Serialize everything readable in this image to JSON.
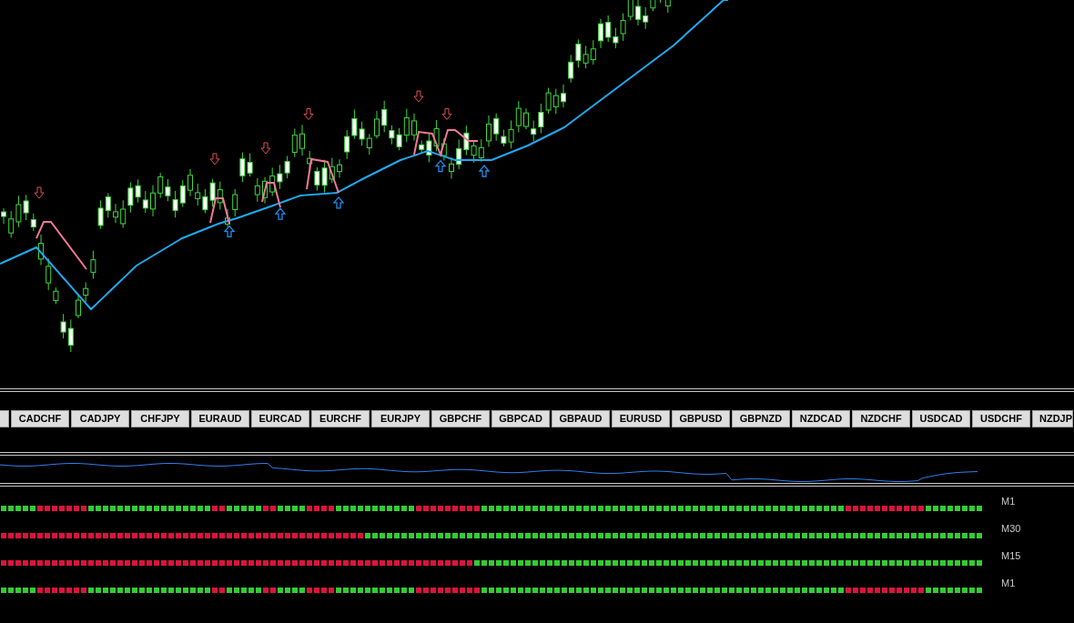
{
  "pair_buttons": [
    {
      "label": "CADCHF"
    },
    {
      "label": "CADJPY"
    },
    {
      "label": "CHFJPY"
    },
    {
      "label": "EURAUD"
    },
    {
      "label": "EURCAD"
    },
    {
      "label": "EURCHF"
    },
    {
      "label": "EURJPY"
    },
    {
      "label": "GBPCHF"
    },
    {
      "label": "GBPCAD"
    },
    {
      "label": "GBPAUD"
    },
    {
      "label": "EURUSD"
    },
    {
      "label": "GBPUSD"
    },
    {
      "label": "GBPNZD"
    },
    {
      "label": "NZDCAD"
    },
    {
      "label": "NZDCHF"
    },
    {
      "label": "USDCAD"
    },
    {
      "label": "USDCHF"
    },
    {
      "label": "NZDJP"
    }
  ],
  "signal_rows": [
    {
      "label": "M1",
      "cells": [
        {
          "color": "#33cc33"
        },
        {
          "color": "#33cc33"
        },
        {
          "color": "#33cc33"
        },
        {
          "color": "#33cc33"
        },
        {
          "color": "#33cc33"
        },
        {
          "color": "#dc143c"
        },
        {
          "color": "#dc143c"
        },
        {
          "color": "#dc143c"
        },
        {
          "color": "#dc143c"
        },
        {
          "color": "#dc143c"
        },
        {
          "color": "#dc143c"
        },
        {
          "color": "#dc143c"
        },
        {
          "color": "#33cc33"
        },
        {
          "color": "#33cc33"
        },
        {
          "color": "#33cc33"
        },
        {
          "color": "#33cc33"
        },
        {
          "color": "#33cc33"
        },
        {
          "color": "#33cc33"
        },
        {
          "color": "#33cc33"
        },
        {
          "color": "#33cc33"
        },
        {
          "color": "#33cc33"
        },
        {
          "color": "#33cc33"
        },
        {
          "color": "#33cc33"
        },
        {
          "color": "#33cc33"
        },
        {
          "color": "#33cc33"
        },
        {
          "color": "#33cc33"
        },
        {
          "color": "#33cc33"
        },
        {
          "color": "#33cc33"
        },
        {
          "color": "#33cc33"
        },
        {
          "color": "#dc143c"
        },
        {
          "color": "#dc143c"
        },
        {
          "color": "#33cc33"
        },
        {
          "color": "#33cc33"
        },
        {
          "color": "#33cc33"
        },
        {
          "color": "#33cc33"
        },
        {
          "color": "#33cc33"
        },
        {
          "color": "#dc143c"
        },
        {
          "color": "#dc143c"
        },
        {
          "color": "#33cc33"
        },
        {
          "color": "#33cc33"
        },
        {
          "color": "#33cc33"
        },
        {
          "color": "#33cc33"
        },
        {
          "color": "#dc143c"
        },
        {
          "color": "#dc143c"
        },
        {
          "color": "#dc143c"
        },
        {
          "color": "#dc143c"
        },
        {
          "color": "#33cc33"
        },
        {
          "color": "#33cc33"
        },
        {
          "color": "#33cc33"
        },
        {
          "color": "#33cc33"
        },
        {
          "color": "#33cc33"
        },
        {
          "color": "#33cc33"
        },
        {
          "color": "#33cc33"
        },
        {
          "color": "#33cc33"
        },
        {
          "color": "#33cc33"
        },
        {
          "color": "#33cc33"
        },
        {
          "color": "#33cc33"
        },
        {
          "color": "#dc143c"
        },
        {
          "color": "#dc143c"
        },
        {
          "color": "#dc143c"
        },
        {
          "color": "#dc143c"
        },
        {
          "color": "#dc143c"
        },
        {
          "color": "#dc143c"
        },
        {
          "color": "#dc143c"
        },
        {
          "color": "#dc143c"
        },
        {
          "color": "#dc143c"
        },
        {
          "color": "#33cc33"
        },
        {
          "color": "#33cc33"
        },
        {
          "color": "#33cc33"
        },
        {
          "color": "#33cc33"
        },
        {
          "color": "#33cc33"
        },
        {
          "color": "#33cc33"
        },
        {
          "color": "#33cc33"
        },
        {
          "color": "#33cc33"
        },
        {
          "color": "#33cc33"
        },
        {
          "color": "#33cc33"
        },
        {
          "color": "#33cc33"
        },
        {
          "color": "#33cc33"
        },
        {
          "color": "#33cc33"
        },
        {
          "color": "#33cc33"
        },
        {
          "color": "#33cc33"
        },
        {
          "color": "#33cc33"
        },
        {
          "color": "#33cc33"
        },
        {
          "color": "#33cc33"
        },
        {
          "color": "#33cc33"
        },
        {
          "color": "#33cc33"
        },
        {
          "color": "#33cc33"
        },
        {
          "color": "#33cc33"
        },
        {
          "color": "#33cc33"
        },
        {
          "color": "#33cc33"
        },
        {
          "color": "#33cc33"
        },
        {
          "color": "#33cc33"
        },
        {
          "color": "#33cc33"
        },
        {
          "color": "#33cc33"
        },
        {
          "color": "#33cc33"
        },
        {
          "color": "#33cc33"
        },
        {
          "color": "#33cc33"
        },
        {
          "color": "#33cc33"
        },
        {
          "color": "#33cc33"
        },
        {
          "color": "#33cc33"
        },
        {
          "color": "#33cc33"
        },
        {
          "color": "#33cc33"
        },
        {
          "color": "#33cc33"
        },
        {
          "color": "#33cc33"
        },
        {
          "color": "#33cc33"
        },
        {
          "color": "#33cc33"
        },
        {
          "color": "#33cc33"
        },
        {
          "color": "#33cc33"
        },
        {
          "color": "#33cc33"
        },
        {
          "color": "#33cc33"
        },
        {
          "color": "#33cc33"
        },
        {
          "color": "#33cc33"
        },
        {
          "color": "#33cc33"
        },
        {
          "color": "#33cc33"
        },
        {
          "color": "#33cc33"
        },
        {
          "color": "#33cc33"
        },
        {
          "color": "#dc143c"
        },
        {
          "color": "#dc143c"
        },
        {
          "color": "#dc143c"
        },
        {
          "color": "#dc143c"
        },
        {
          "color": "#dc143c"
        },
        {
          "color": "#dc143c"
        },
        {
          "color": "#dc143c"
        },
        {
          "color": "#dc143c"
        },
        {
          "color": "#dc143c"
        },
        {
          "color": "#dc143c"
        },
        {
          "color": "#dc143c"
        },
        {
          "color": "#33cc33"
        },
        {
          "color": "#33cc33"
        },
        {
          "color": "#33cc33"
        },
        {
          "color": "#33cc33"
        },
        {
          "color": "#33cc33"
        },
        {
          "color": "#33cc33"
        },
        {
          "color": "#33cc33"
        },
        {
          "color": "#33cc33"
        }
      ]
    },
    {
      "label": "M30",
      "cells": [
        {
          "color": "#dc143c"
        },
        {
          "color": "#dc143c"
        },
        {
          "color": "#dc143c"
        },
        {
          "color": "#dc143c"
        },
        {
          "color": "#dc143c"
        },
        {
          "color": "#dc143c"
        },
        {
          "color": "#dc143c"
        },
        {
          "color": "#dc143c"
        },
        {
          "color": "#dc143c"
        },
        {
          "color": "#dc143c"
        },
        {
          "color": "#dc143c"
        },
        {
          "color": "#dc143c"
        },
        {
          "color": "#dc143c"
        },
        {
          "color": "#dc143c"
        },
        {
          "color": "#dc143c"
        },
        {
          "color": "#dc143c"
        },
        {
          "color": "#dc143c"
        },
        {
          "color": "#dc143c"
        },
        {
          "color": "#dc143c"
        },
        {
          "color": "#dc143c"
        },
        {
          "color": "#dc143c"
        },
        {
          "color": "#dc143c"
        },
        {
          "color": "#dc143c"
        },
        {
          "color": "#dc143c"
        },
        {
          "color": "#dc143c"
        },
        {
          "color": "#dc143c"
        },
        {
          "color": "#dc143c"
        },
        {
          "color": "#dc143c"
        },
        {
          "color": "#dc143c"
        },
        {
          "color": "#dc143c"
        },
        {
          "color": "#dc143c"
        },
        {
          "color": "#dc143c"
        },
        {
          "color": "#dc143c"
        },
        {
          "color": "#dc143c"
        },
        {
          "color": "#dc143c"
        },
        {
          "color": "#dc143c"
        },
        {
          "color": "#dc143c"
        },
        {
          "color": "#dc143c"
        },
        {
          "color": "#dc143c"
        },
        {
          "color": "#dc143c"
        },
        {
          "color": "#dc143c"
        },
        {
          "color": "#dc143c"
        },
        {
          "color": "#dc143c"
        },
        {
          "color": "#dc143c"
        },
        {
          "color": "#dc143c"
        },
        {
          "color": "#dc143c"
        },
        {
          "color": "#dc143c"
        },
        {
          "color": "#dc143c"
        },
        {
          "color": "#dc143c"
        },
        {
          "color": "#dc143c"
        },
        {
          "color": "#33cc33"
        },
        {
          "color": "#33cc33"
        },
        {
          "color": "#33cc33"
        },
        {
          "color": "#33cc33"
        },
        {
          "color": "#33cc33"
        },
        {
          "color": "#33cc33"
        },
        {
          "color": "#33cc33"
        },
        {
          "color": "#33cc33"
        },
        {
          "color": "#33cc33"
        },
        {
          "color": "#33cc33"
        },
        {
          "color": "#33cc33"
        },
        {
          "color": "#33cc33"
        },
        {
          "color": "#33cc33"
        },
        {
          "color": "#33cc33"
        },
        {
          "color": "#33cc33"
        },
        {
          "color": "#33cc33"
        },
        {
          "color": "#33cc33"
        },
        {
          "color": "#33cc33"
        },
        {
          "color": "#33cc33"
        },
        {
          "color": "#33cc33"
        },
        {
          "color": "#33cc33"
        },
        {
          "color": "#33cc33"
        },
        {
          "color": "#33cc33"
        },
        {
          "color": "#33cc33"
        },
        {
          "color": "#33cc33"
        },
        {
          "color": "#33cc33"
        },
        {
          "color": "#33cc33"
        },
        {
          "color": "#33cc33"
        },
        {
          "color": "#33cc33"
        },
        {
          "color": "#33cc33"
        },
        {
          "color": "#33cc33"
        },
        {
          "color": "#33cc33"
        },
        {
          "color": "#33cc33"
        },
        {
          "color": "#33cc33"
        },
        {
          "color": "#33cc33"
        },
        {
          "color": "#33cc33"
        },
        {
          "color": "#33cc33"
        },
        {
          "color": "#33cc33"
        },
        {
          "color": "#33cc33"
        },
        {
          "color": "#33cc33"
        },
        {
          "color": "#33cc33"
        },
        {
          "color": "#33cc33"
        },
        {
          "color": "#33cc33"
        },
        {
          "color": "#33cc33"
        },
        {
          "color": "#33cc33"
        },
        {
          "color": "#33cc33"
        },
        {
          "color": "#33cc33"
        },
        {
          "color": "#33cc33"
        },
        {
          "color": "#33cc33"
        },
        {
          "color": "#33cc33"
        },
        {
          "color": "#33cc33"
        },
        {
          "color": "#33cc33"
        },
        {
          "color": "#33cc33"
        },
        {
          "color": "#33cc33"
        },
        {
          "color": "#33cc33"
        },
        {
          "color": "#33cc33"
        },
        {
          "color": "#33cc33"
        },
        {
          "color": "#33cc33"
        },
        {
          "color": "#33cc33"
        },
        {
          "color": "#33cc33"
        },
        {
          "color": "#33cc33"
        },
        {
          "color": "#33cc33"
        },
        {
          "color": "#33cc33"
        },
        {
          "color": "#33cc33"
        },
        {
          "color": "#33cc33"
        },
        {
          "color": "#33cc33"
        },
        {
          "color": "#33cc33"
        },
        {
          "color": "#33cc33"
        },
        {
          "color": "#33cc33"
        },
        {
          "color": "#33cc33"
        },
        {
          "color": "#33cc33"
        },
        {
          "color": "#33cc33"
        },
        {
          "color": "#33cc33"
        },
        {
          "color": "#33cc33"
        },
        {
          "color": "#33cc33"
        },
        {
          "color": "#33cc33"
        },
        {
          "color": "#33cc33"
        },
        {
          "color": "#33cc33"
        },
        {
          "color": "#33cc33"
        },
        {
          "color": "#33cc33"
        },
        {
          "color": "#33cc33"
        },
        {
          "color": "#33cc33"
        },
        {
          "color": "#33cc33"
        },
        {
          "color": "#33cc33"
        },
        {
          "color": "#33cc33"
        }
      ]
    },
    {
      "label": "M15",
      "cells": [
        {
          "color": "#dc143c"
        },
        {
          "color": "#dc143c"
        },
        {
          "color": "#dc143c"
        },
        {
          "color": "#dc143c"
        },
        {
          "color": "#dc143c"
        },
        {
          "color": "#dc143c"
        },
        {
          "color": "#dc143c"
        },
        {
          "color": "#dc143c"
        },
        {
          "color": "#dc143c"
        },
        {
          "color": "#dc143c"
        },
        {
          "color": "#dc143c"
        },
        {
          "color": "#dc143c"
        },
        {
          "color": "#dc143c"
        },
        {
          "color": "#dc143c"
        },
        {
          "color": "#dc143c"
        },
        {
          "color": "#dc143c"
        },
        {
          "color": "#dc143c"
        },
        {
          "color": "#dc143c"
        },
        {
          "color": "#dc143c"
        },
        {
          "color": "#dc143c"
        },
        {
          "color": "#dc143c"
        },
        {
          "color": "#dc143c"
        },
        {
          "color": "#dc143c"
        },
        {
          "color": "#dc143c"
        },
        {
          "color": "#dc143c"
        },
        {
          "color": "#dc143c"
        },
        {
          "color": "#dc143c"
        },
        {
          "color": "#dc143c"
        },
        {
          "color": "#dc143c"
        },
        {
          "color": "#dc143c"
        },
        {
          "color": "#dc143c"
        },
        {
          "color": "#dc143c"
        },
        {
          "color": "#dc143c"
        },
        {
          "color": "#dc143c"
        },
        {
          "color": "#dc143c"
        },
        {
          "color": "#dc143c"
        },
        {
          "color": "#dc143c"
        },
        {
          "color": "#dc143c"
        },
        {
          "color": "#dc143c"
        },
        {
          "color": "#dc143c"
        },
        {
          "color": "#dc143c"
        },
        {
          "color": "#dc143c"
        },
        {
          "color": "#dc143c"
        },
        {
          "color": "#dc143c"
        },
        {
          "color": "#dc143c"
        },
        {
          "color": "#dc143c"
        },
        {
          "color": "#dc143c"
        },
        {
          "color": "#dc143c"
        },
        {
          "color": "#dc143c"
        },
        {
          "color": "#dc143c"
        },
        {
          "color": "#dc143c"
        },
        {
          "color": "#dc143c"
        },
        {
          "color": "#dc143c"
        },
        {
          "color": "#dc143c"
        },
        {
          "color": "#dc143c"
        },
        {
          "color": "#dc143c"
        },
        {
          "color": "#dc143c"
        },
        {
          "color": "#dc143c"
        },
        {
          "color": "#dc143c"
        },
        {
          "color": "#dc143c"
        },
        {
          "color": "#dc143c"
        },
        {
          "color": "#dc143c"
        },
        {
          "color": "#dc143c"
        },
        {
          "color": "#dc143c"
        },
        {
          "color": "#dc143c"
        },
        {
          "color": "#33cc33"
        },
        {
          "color": "#33cc33"
        },
        {
          "color": "#33cc33"
        },
        {
          "color": "#33cc33"
        },
        {
          "color": "#33cc33"
        },
        {
          "color": "#33cc33"
        },
        {
          "color": "#33cc33"
        },
        {
          "color": "#33cc33"
        },
        {
          "color": "#33cc33"
        },
        {
          "color": "#33cc33"
        },
        {
          "color": "#33cc33"
        },
        {
          "color": "#33cc33"
        },
        {
          "color": "#33cc33"
        },
        {
          "color": "#33cc33"
        },
        {
          "color": "#33cc33"
        },
        {
          "color": "#33cc33"
        },
        {
          "color": "#33cc33"
        },
        {
          "color": "#33cc33"
        },
        {
          "color": "#33cc33"
        },
        {
          "color": "#33cc33"
        },
        {
          "color": "#33cc33"
        },
        {
          "color": "#33cc33"
        },
        {
          "color": "#33cc33"
        },
        {
          "color": "#33cc33"
        },
        {
          "color": "#33cc33"
        },
        {
          "color": "#33cc33"
        },
        {
          "color": "#33cc33"
        },
        {
          "color": "#33cc33"
        },
        {
          "color": "#33cc33"
        },
        {
          "color": "#33cc33"
        },
        {
          "color": "#33cc33"
        },
        {
          "color": "#33cc33"
        },
        {
          "color": "#33cc33"
        },
        {
          "color": "#33cc33"
        },
        {
          "color": "#33cc33"
        },
        {
          "color": "#33cc33"
        },
        {
          "color": "#33cc33"
        },
        {
          "color": "#33cc33"
        },
        {
          "color": "#33cc33"
        },
        {
          "color": "#33cc33"
        },
        {
          "color": "#33cc33"
        },
        {
          "color": "#33cc33"
        },
        {
          "color": "#33cc33"
        },
        {
          "color": "#33cc33"
        },
        {
          "color": "#33cc33"
        },
        {
          "color": "#33cc33"
        },
        {
          "color": "#33cc33"
        },
        {
          "color": "#33cc33"
        },
        {
          "color": "#33cc33"
        },
        {
          "color": "#33cc33"
        },
        {
          "color": "#33cc33"
        },
        {
          "color": "#33cc33"
        },
        {
          "color": "#33cc33"
        },
        {
          "color": "#33cc33"
        },
        {
          "color": "#33cc33"
        },
        {
          "color": "#33cc33"
        },
        {
          "color": "#33cc33"
        },
        {
          "color": "#33cc33"
        },
        {
          "color": "#33cc33"
        },
        {
          "color": "#33cc33"
        },
        {
          "color": "#33cc33"
        },
        {
          "color": "#33cc33"
        },
        {
          "color": "#33cc33"
        },
        {
          "color": "#33cc33"
        },
        {
          "color": "#33cc33"
        },
        {
          "color": "#33cc33"
        },
        {
          "color": "#33cc33"
        },
        {
          "color": "#33cc33"
        },
        {
          "color": "#33cc33"
        },
        {
          "color": "#33cc33"
        }
      ]
    },
    {
      "label": "M1",
      "cells": [
        {
          "color": "#33cc33"
        },
        {
          "color": "#33cc33"
        },
        {
          "color": "#33cc33"
        },
        {
          "color": "#33cc33"
        },
        {
          "color": "#33cc33"
        },
        {
          "color": "#dc143c"
        },
        {
          "color": "#dc143c"
        },
        {
          "color": "#dc143c"
        },
        {
          "color": "#dc143c"
        },
        {
          "color": "#dc143c"
        },
        {
          "color": "#dc143c"
        },
        {
          "color": "#dc143c"
        },
        {
          "color": "#33cc33"
        },
        {
          "color": "#33cc33"
        },
        {
          "color": "#33cc33"
        },
        {
          "color": "#33cc33"
        },
        {
          "color": "#33cc33"
        },
        {
          "color": "#33cc33"
        },
        {
          "color": "#33cc33"
        },
        {
          "color": "#33cc33"
        },
        {
          "color": "#33cc33"
        },
        {
          "color": "#33cc33"
        },
        {
          "color": "#33cc33"
        },
        {
          "color": "#33cc33"
        },
        {
          "color": "#33cc33"
        },
        {
          "color": "#33cc33"
        },
        {
          "color": "#33cc33"
        },
        {
          "color": "#33cc33"
        },
        {
          "color": "#33cc33"
        },
        {
          "color": "#dc143c"
        },
        {
          "color": "#dc143c"
        },
        {
          "color": "#33cc33"
        },
        {
          "color": "#33cc33"
        },
        {
          "color": "#33cc33"
        },
        {
          "color": "#33cc33"
        },
        {
          "color": "#33cc33"
        },
        {
          "color": "#dc143c"
        },
        {
          "color": "#dc143c"
        },
        {
          "color": "#33cc33"
        },
        {
          "color": "#33cc33"
        },
        {
          "color": "#33cc33"
        },
        {
          "color": "#33cc33"
        },
        {
          "color": "#dc143c"
        },
        {
          "color": "#dc143c"
        },
        {
          "color": "#dc143c"
        },
        {
          "color": "#dc143c"
        },
        {
          "color": "#33cc33"
        },
        {
          "color": "#33cc33"
        },
        {
          "color": "#33cc33"
        },
        {
          "color": "#33cc33"
        },
        {
          "color": "#33cc33"
        },
        {
          "color": "#33cc33"
        },
        {
          "color": "#33cc33"
        },
        {
          "color": "#33cc33"
        },
        {
          "color": "#33cc33"
        },
        {
          "color": "#33cc33"
        },
        {
          "color": "#33cc33"
        },
        {
          "color": "#dc143c"
        },
        {
          "color": "#dc143c"
        },
        {
          "color": "#dc143c"
        },
        {
          "color": "#dc143c"
        },
        {
          "color": "#dc143c"
        },
        {
          "color": "#dc143c"
        },
        {
          "color": "#dc143c"
        },
        {
          "color": "#dc143c"
        },
        {
          "color": "#dc143c"
        },
        {
          "color": "#33cc33"
        },
        {
          "color": "#33cc33"
        },
        {
          "color": "#33cc33"
        },
        {
          "color": "#33cc33"
        },
        {
          "color": "#33cc33"
        },
        {
          "color": "#33cc33"
        },
        {
          "color": "#33cc33"
        },
        {
          "color": "#33cc33"
        },
        {
          "color": "#33cc33"
        },
        {
          "color": "#33cc33"
        },
        {
          "color": "#33cc33"
        },
        {
          "color": "#33cc33"
        },
        {
          "color": "#33cc33"
        },
        {
          "color": "#33cc33"
        },
        {
          "color": "#33cc33"
        },
        {
          "color": "#33cc33"
        },
        {
          "color": "#33cc33"
        },
        {
          "color": "#33cc33"
        },
        {
          "color": "#33cc33"
        },
        {
          "color": "#33cc33"
        },
        {
          "color": "#33cc33"
        },
        {
          "color": "#33cc33"
        },
        {
          "color": "#33cc33"
        },
        {
          "color": "#33cc33"
        },
        {
          "color": "#33cc33"
        },
        {
          "color": "#33cc33"
        },
        {
          "color": "#33cc33"
        },
        {
          "color": "#33cc33"
        },
        {
          "color": "#33cc33"
        },
        {
          "color": "#33cc33"
        },
        {
          "color": "#33cc33"
        },
        {
          "color": "#33cc33"
        },
        {
          "color": "#33cc33"
        },
        {
          "color": "#33cc33"
        },
        {
          "color": "#33cc33"
        },
        {
          "color": "#33cc33"
        },
        {
          "color": "#33cc33"
        },
        {
          "color": "#33cc33"
        },
        {
          "color": "#33cc33"
        },
        {
          "color": "#33cc33"
        },
        {
          "color": "#33cc33"
        },
        {
          "color": "#33cc33"
        },
        {
          "color": "#33cc33"
        },
        {
          "color": "#33cc33"
        },
        {
          "color": "#33cc33"
        },
        {
          "color": "#33cc33"
        },
        {
          "color": "#33cc33"
        },
        {
          "color": "#33cc33"
        },
        {
          "color": "#33cc33"
        },
        {
          "color": "#33cc33"
        },
        {
          "color": "#dc143c"
        },
        {
          "color": "#dc143c"
        },
        {
          "color": "#dc143c"
        },
        {
          "color": "#dc143c"
        },
        {
          "color": "#dc143c"
        },
        {
          "color": "#dc143c"
        },
        {
          "color": "#dc143c"
        },
        {
          "color": "#dc143c"
        },
        {
          "color": "#dc143c"
        },
        {
          "color": "#dc143c"
        },
        {
          "color": "#dc143c"
        },
        {
          "color": "#33cc33"
        },
        {
          "color": "#33cc33"
        },
        {
          "color": "#33cc33"
        },
        {
          "color": "#33cc33"
        },
        {
          "color": "#33cc33"
        },
        {
          "color": "#33cc33"
        },
        {
          "color": "#33cc33"
        },
        {
          "color": "#33cc33"
        }
      ]
    }
  ]
}
